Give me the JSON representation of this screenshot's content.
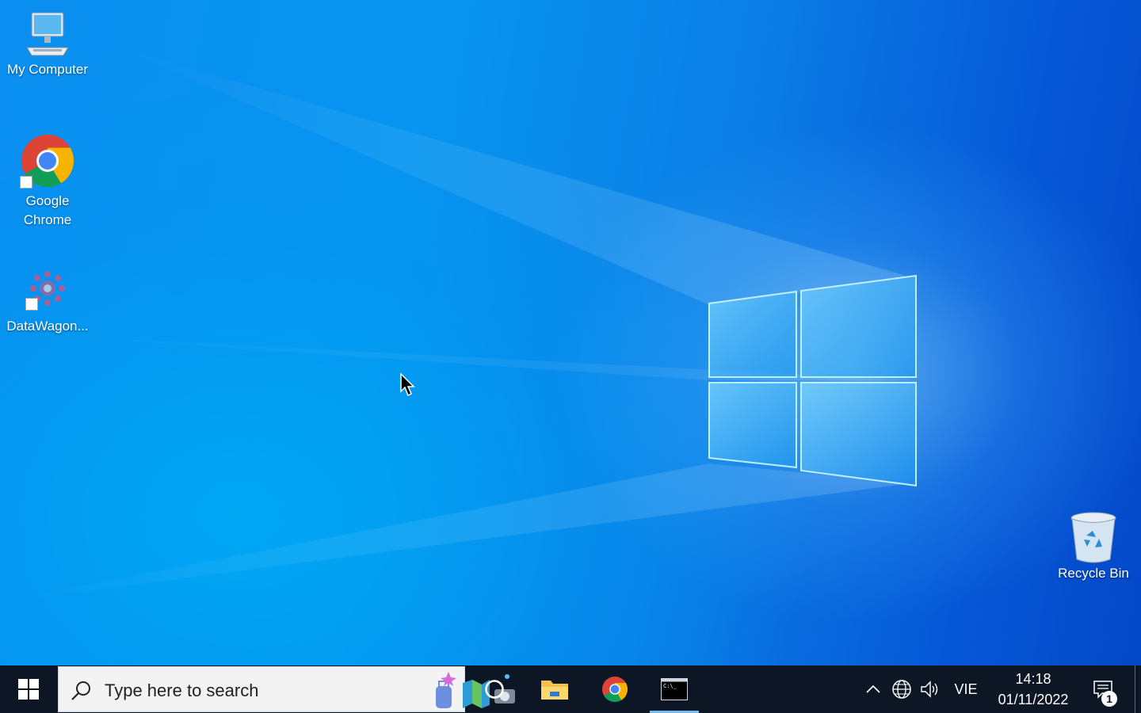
{
  "desktop": {
    "icons": [
      {
        "label": "My Computer",
        "icon": "computer-icon"
      },
      {
        "label": "Google Chrome",
        "icon": "chrome-icon",
        "shortcut": true
      },
      {
        "label": "DataWagon...",
        "icon": "datawagon-icon",
        "shortcut": true
      },
      {
        "label": "Recycle Bin",
        "icon": "recycle-bin-icon"
      }
    ]
  },
  "taskbar": {
    "start_icon": "windows-logo-icon",
    "search": {
      "placeholder": "Type here to search",
      "icon": "search-icon",
      "highlight_icon": "search-highlight-travel-icon"
    },
    "buttons": [
      {
        "name": "cortana",
        "icon": "cortana-circle-icon"
      },
      {
        "name": "file-explorer",
        "icon": "folder-icon"
      },
      {
        "name": "google-chrome",
        "icon": "chrome-icon"
      },
      {
        "name": "command-prompt",
        "icon": "terminal-icon",
        "active": true
      }
    ],
    "tray": {
      "overflow_icon": "chevron-up-icon",
      "network_icon": "globe-icon",
      "volume_icon": "speaker-icon",
      "language": "VIE",
      "time": "14:18",
      "date": "01/11/2022",
      "notification_count": "1"
    }
  },
  "colors": {
    "taskbar_bg": "#0c1624",
    "desktop_blue": "#0795f0",
    "active_underline": "#76b9ed"
  }
}
